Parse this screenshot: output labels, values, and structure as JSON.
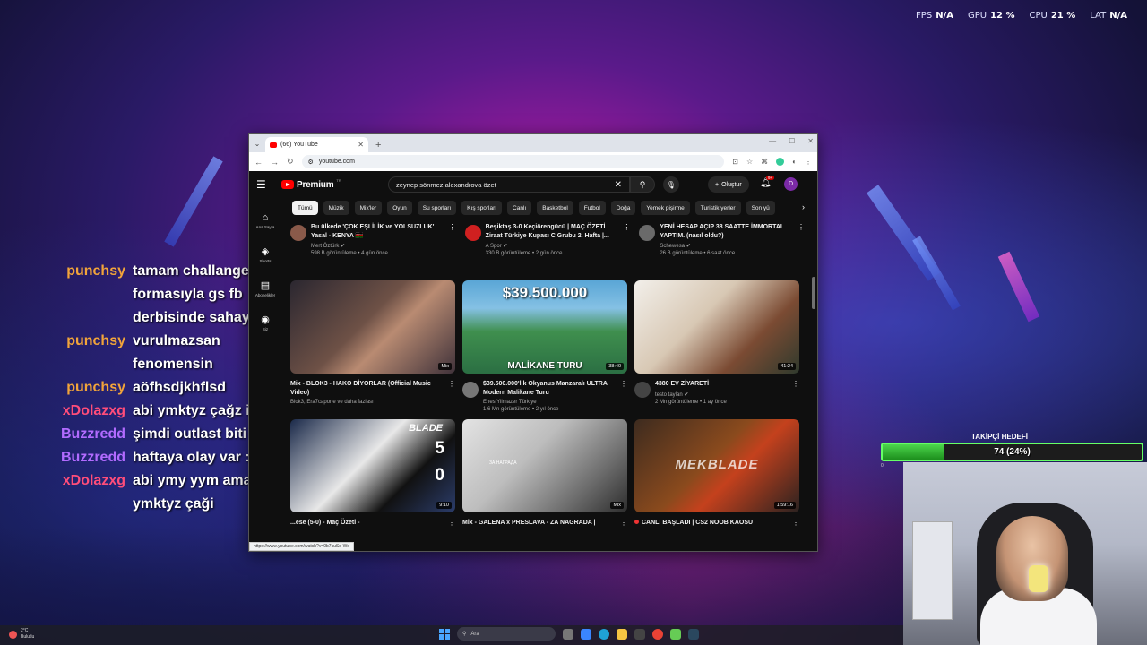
{
  "overlay_stats": [
    {
      "label": "FPS",
      "value": "N/A"
    },
    {
      "label": "GPU",
      "value": "12 %"
    },
    {
      "label": "CPU",
      "value": "21 %"
    },
    {
      "label": "LAT",
      "value": "N/A"
    }
  ],
  "chat": [
    {
      "user": "punchsy",
      "color": "#f2a43a",
      "lines": [
        "tamam challange bjk"
      ]
    },
    {
      "user": "",
      "color": "#f2a43a",
      "lines": [
        "formasıyla gs fb"
      ]
    },
    {
      "user": "",
      "color": "#f2a43a",
      "lines": [
        "derbisinde sahaya atla"
      ]
    },
    {
      "user": "punchsy",
      "color": "#f2a43a",
      "lines": [
        "vurulmazsan"
      ]
    },
    {
      "user": "",
      "color": "#f2a43a",
      "lines": [
        "fenomensin"
      ]
    },
    {
      "user": "punchsy",
      "color": "#f2a43a",
      "lines": [
        "aöfhsdjkhflsd"
      ]
    },
    {
      "user": "xDolazxg",
      "color": "#ff4d7a",
      "lines": [
        "abi ymktyz çağz izlsn"
      ]
    },
    {
      "user": "Buzzredd",
      "color": "#b26bff",
      "lines": [
        "şimdi outlast biti mi"
      ]
    },
    {
      "user": "Buzzredd",
      "color": "#b26bff",
      "lines": [
        "haftaya olay var :D"
      ]
    },
    {
      "user": "xDolazxg",
      "color": "#ff4d7a",
      "lines": [
        "abi ymy yym ama"
      ]
    },
    {
      "user": "",
      "color": "#ff4d7a",
      "lines": [
        "ymktyz çaği"
      ]
    }
  ],
  "browser": {
    "tab_title": "(66) YouTube",
    "url": "youtube.com",
    "status_url": "https://www.youtube.com/watch?v=0b7kuSd-Wo"
  },
  "youtube": {
    "brand": "Premium",
    "country": "TR",
    "search_query": "zeynep sönmez alexandrova özet",
    "create_label": "Oluştur",
    "notif_count": "9+",
    "avatar_letter": "D",
    "chips": [
      "Tümü",
      "Müzik",
      "Mix'ler",
      "Oyun",
      "Su sporları",
      "Kış sporları",
      "Canlı",
      "Basketbol",
      "Futbol",
      "Doğa",
      "Yemek pişirme",
      "Turistik yerler",
      "Son yü"
    ],
    "sidebar": [
      {
        "icon": "⌂",
        "label": "Ana Sayfa"
      },
      {
        "icon": "◈",
        "label": "Shorts"
      },
      {
        "icon": "▤",
        "label": "Abonelikler"
      },
      {
        "icon": "◉",
        "label": "Siz"
      }
    ],
    "row1": [
      {
        "title": "Bu ülkede 'ÇOK EŞLİLİK ve YOLSUZLUK' Yasal - KENYA 🇰🇪",
        "channel": "Mert Öztürk ✔",
        "stats": "598 B görüntüleme • 4 gün önce",
        "avatar": "#8a5a4a"
      },
      {
        "title": "Beşiktaş 3-0 Keçiörengücü | MAÇ ÖZETİ | Ziraat Türkiye Kupası C Grubu 2. Hafta |...",
        "channel": "A Spor ✔",
        "stats": "330 B görüntüleme • 2 gün önce",
        "avatar": "#d02020"
      },
      {
        "title": "YENİ HESAP AÇIP 38 SAATTE İMMORTAL YAPTIM. (nasıl oldu?)",
        "channel": "Schewesa ✔",
        "stats": "26 B görüntüleme • 6 saat önce",
        "avatar": "#6a6a6a"
      }
    ],
    "grid1": [
      {
        "title": "Mix - BLOK3 - HAKO DİYORLAR (Official Music Video)",
        "channel": "Blok3, Era7capone ve daha fazlası",
        "stats": "",
        "badge": "Mix"
      },
      {
        "title": "$39.500.000'lık Okyanus Manzaralı ULTRA Modern Malikane Turu",
        "channel": "Enes Yilmazer Türkiye",
        "stats": "1,6 Mn görüntüleme • 2 yıl önce",
        "duration": "38:40",
        "big": "$39.500.000",
        "sub": "MALİKANE TURU",
        "avatar": "#777"
      },
      {
        "title": "4380 EV ZİYARETİ",
        "channel": "testo taylan ✔",
        "stats": "2 Mn görüntüleme • 1 ay önce",
        "duration": "41:24",
        "avatar": "#444"
      }
    ],
    "grid2": [
      {
        "title": "...ese (5-0) - Maç Özeti -",
        "duration": "9:10",
        "blade": "BLADE",
        "score_a": "5",
        "score_b": "0"
      },
      {
        "title": "Mix - GALENA x PRESLAVA - ZA NAGRADA |",
        "badge": "Mix",
        "za": "ЗА НАГРАДА"
      },
      {
        "title": "CANLI BAŞLADI | CS2 NOOB KAOSU",
        "duration": "1:59:16",
        "mek": "MEKBLADE"
      }
    ]
  },
  "follower_goal": {
    "title": "TAKİPÇİ HEDEFİ",
    "text": "74 (24%)",
    "fraction": 0.24,
    "min_label": "0"
  },
  "taskbar": {
    "temp": "2°C",
    "weather": "Bulutlu",
    "search_placeholder": "Ara"
  }
}
